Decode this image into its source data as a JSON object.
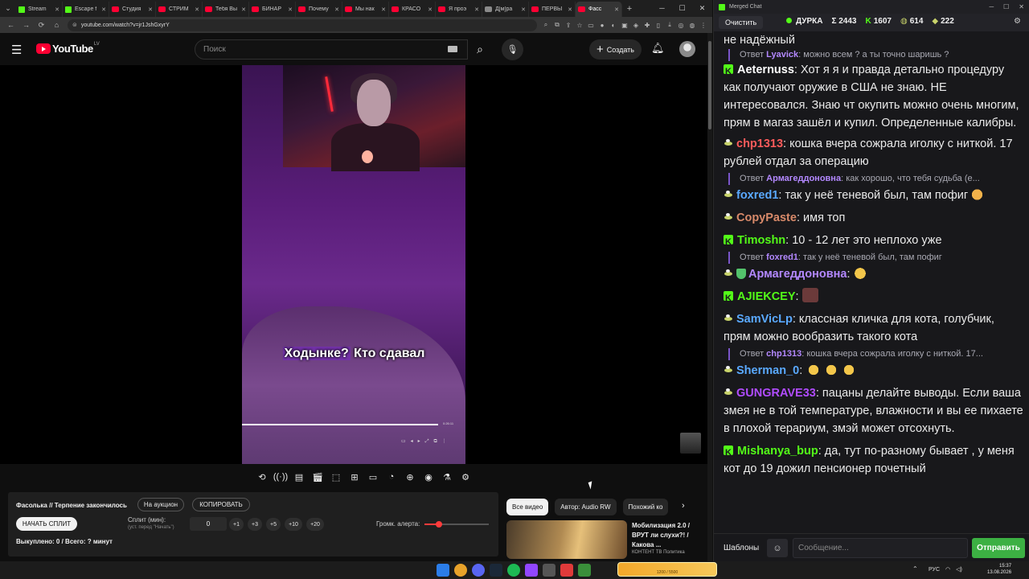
{
  "browser": {
    "tabs": [
      {
        "title": "Stream",
        "fav": "green",
        "active": false
      },
      {
        "title": "Escape f",
        "fav": "green",
        "active": false
      },
      {
        "title": "Студия",
        "fav": "red",
        "active": false
      },
      {
        "title": "СТРИМ",
        "fav": "red",
        "active": false
      },
      {
        "title": "Тебя Вы",
        "fav": "red",
        "active": false
      },
      {
        "title": "БИНАР",
        "fav": "red",
        "active": false
      },
      {
        "title": "Почему",
        "fav": "red",
        "active": false
      },
      {
        "title": "Мы нак",
        "fav": "red",
        "active": false
      },
      {
        "title": "КРАСО",
        "fav": "red",
        "active": false
      },
      {
        "title": "Я проэ",
        "fav": "red",
        "active": false
      },
      {
        "title": "Д[м]ра",
        "fav": "gray",
        "active": false
      },
      {
        "title": "ПЕРВЫ",
        "fav": "red",
        "active": false
      },
      {
        "title": "Фасс",
        "fav": "red",
        "active": true
      }
    ],
    "new_tab": "+",
    "url": "youtube.com/watch?v=jr1JshGxyrY"
  },
  "youtube": {
    "logo_text": "YouTube",
    "country": "LV",
    "search_placeholder": "Поиск",
    "create_label": "Создать",
    "subtitle_highlight": "Ходынке?",
    "subtitle_rest": " Кто сдавал",
    "inner_time": "0:26:11"
  },
  "split": {
    "title": "Фасолька // Терпение закончилось",
    "auction_label": "На аукцион",
    "copy_label": "КОПИРОВАТЬ",
    "start_label": "НАЧАТЬ СПЛИТ",
    "split_label": "Сплит (мин):",
    "split_hint": "(уст. перед \"Начать\")",
    "minutes_value": "0",
    "chips": [
      "+1",
      "+3",
      "+5",
      "+10",
      "+20"
    ],
    "volume_label": "Громк. алерта:",
    "volume_level": 0.23,
    "status": "Выкуплено: 0 / Всего: ? минут"
  },
  "recs": {
    "chips": [
      "Все видео",
      "Автор: Audio RW",
      "Похожий ко"
    ],
    "video_title": "Мобилизация 2.0 / ВРУТ ли слухи?! / Какова ...",
    "video_channel": "КОНТЕНТ ТВ Политика"
  },
  "chat": {
    "window_title": "Merged Chat",
    "clear_label": "Очистить",
    "streamer": "ДУРКА",
    "stat_sigma": "Σ 2443",
    "stat_kick": "1607",
    "stat_b": "614",
    "stat_c": "222",
    "templates_label": "Шаблоны",
    "input_placeholder": "Сообщение...",
    "send_label": "Отправить",
    "messages": {
      "m0": {
        "text": "не надёжный"
      },
      "r1": {
        "prefix": "Ответ",
        "user": "Lyavick",
        "user_color": "#b388ff",
        "text": ": можно всем ? а ты точно шаришь ?"
      },
      "m1": {
        "user": "Aeternuss",
        "user_color": "#ffffff",
        "text": ": Хот я я и правда детально процедуру как получают оружие в США не знаю. НЕ интересовался. Знаю чт окупить можно очень многим, прям в магаз зашёл и купил. Определенные калибры."
      },
      "m2": {
        "user": "chp1313",
        "user_color": "#ff5b5b",
        "text": ": кошка вчера сожрала иголку с ниткой. 17 рублей отдал за операцию"
      },
      "r2": {
        "prefix": "Ответ",
        "user": "Армагеддоновна",
        "user_color": "#b388ff",
        "text": ": как хорошо, что тебя судьба (е..."
      },
      "m3": {
        "user": "foxred1",
        "user_color": "#5aa9ff",
        "text": ": так у неё теневой был, там пофиг"
      },
      "m4": {
        "user": "CopyPaste",
        "user_color": "#d98a6a",
        "text": ": имя топ"
      },
      "m5": {
        "user": "Timoshn",
        "user_color": "#53fc18",
        "text": ": 10 - 12 лет это неплохо уже"
      },
      "r3": {
        "prefix": "Ответ",
        "user": "foxred1",
        "user_color": "#b388ff",
        "text": ": так у неё теневой был, там пофиг"
      },
      "m6": {
        "user": "Армагеддоновна",
        "user_color": "#b388ff",
        "text": ":"
      },
      "m7": {
        "user": "AJIEKCEY",
        "user_color": "#53fc18",
        "text": ":"
      },
      "m8": {
        "user": "SamVicLp",
        "user_color": "#5aa9ff",
        "text": ": классная кличка для кота, голубчик, прям можно вообразить такого кота"
      },
      "r4": {
        "prefix": "Ответ",
        "user": "chp1313",
        "user_color": "#b388ff",
        "text": ": кошка вчера сожрала иголку с ниткой. 17..."
      },
      "m9": {
        "user": "Sherman_0",
        "user_color": "#5aa9ff",
        "text": ":"
      },
      "m10": {
        "user": "GUNGRAVE33",
        "user_color": "#b14cff",
        "text": ": пацаны делайте выводы. Если ваша змея не в той температуре, влажности и вы ее пихаете в плохой терариум, змэй может отсохнуть."
      },
      "m11": {
        "user": "Mishanya_bup",
        "user_color": "#53fc18",
        "text": ": да, тут по-разному бывает , у меня кот до 19 дожил пенсионер почетный"
      }
    }
  },
  "taskbar": {
    "lang": "РУС",
    "time": "15:37",
    "date": "13.08.2026",
    "widget_text": "1200 / 5500"
  },
  "colors": {
    "kick_green": "#53fc18",
    "yt_red": "#ff0033",
    "send_green": "#3cb043"
  }
}
